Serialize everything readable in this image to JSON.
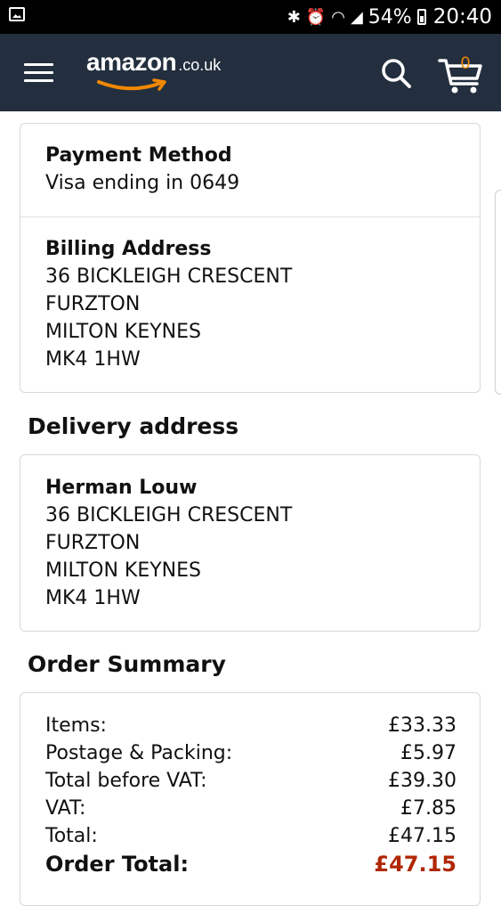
{
  "status_bar": {
    "battery": "54%",
    "time": "20:40",
    "icons": [
      "gallery-notification-icon",
      "bluetooth-icon",
      "alarm-icon",
      "wifi-icon",
      "signal-icon",
      "battery-icon"
    ]
  },
  "header": {
    "logo_main": "amazon",
    "logo_suffix": ".co.uk",
    "cart_count": "0",
    "icons": [
      "menu-icon",
      "search-icon",
      "cart-icon"
    ],
    "colors": {
      "bar": "#232f3e",
      "accent": "#f08804"
    }
  },
  "payment": {
    "method_title": "Payment Method",
    "method_value": "Visa ending in 0649",
    "billing_title": "Billing Address",
    "billing_lines": [
      "36 BICKLEIGH CRESCENT",
      "FURZTON",
      "MILTON KEYNES",
      "MK4 1HW"
    ]
  },
  "delivery": {
    "heading": "Delivery address",
    "name": "Herman Louw",
    "lines": [
      "36 BICKLEIGH CRESCENT",
      "FURZTON",
      "MILTON KEYNES",
      "MK4 1HW"
    ]
  },
  "summary": {
    "heading": "Order Summary",
    "rows": [
      {
        "label": "Items:",
        "value": "£33.33"
      },
      {
        "label": "Postage & Packing:",
        "value": "£5.97"
      },
      {
        "label": "Total before VAT:",
        "value": "£39.30"
      },
      {
        "label": "VAT:",
        "value": "£7.85"
      },
      {
        "label": "Total:",
        "value": "£47.15"
      }
    ],
    "order_total_label": "Order Total:",
    "order_total_value": "£47.15",
    "total_color": "#b12704"
  }
}
